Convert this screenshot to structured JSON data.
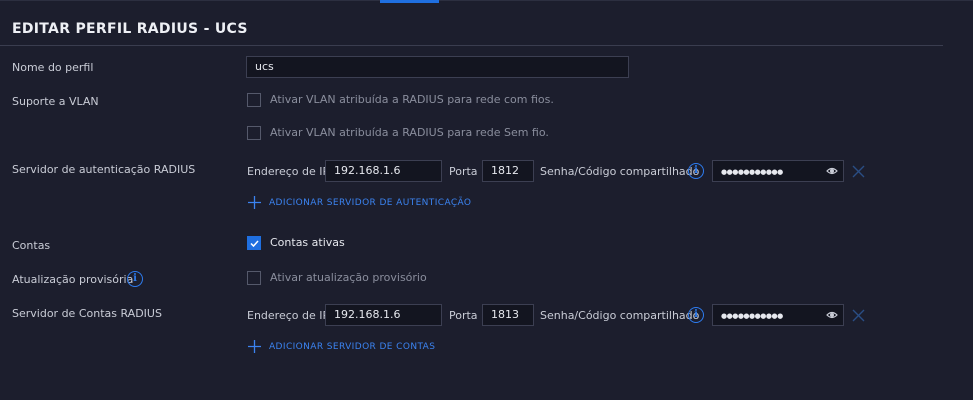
{
  "header": {
    "title": "EDITAR PERFIL RADIUS - UCS"
  },
  "profile": {
    "label": "Nome do perfil",
    "value": "ucs"
  },
  "vlan": {
    "label": "Suporte a VLAN",
    "wired_label": "Ativar VLAN atribuída a RADIUS para rede com fios.",
    "wireless_label": "Ativar VLAN atribuída a RADIUS para rede Sem fio."
  },
  "auth_server": {
    "label": "Servidor de autenticação RADIUS",
    "ip_label": "Endereço de IP",
    "ip_value": "192.168.1.6",
    "port_label": "Porta",
    "port_value": "1812",
    "secret_label": "Senha/Código compartilhado",
    "secret_value": "●●●●●●●●●●●",
    "add_label": "ADICIONAR SERVIDOR DE AUTENTICAÇÃO"
  },
  "accounting": {
    "label": "Contas",
    "enabled_label": "Contas ativas",
    "enabled": true
  },
  "interim": {
    "label": "Atualização provisória",
    "checkbox_label": "Ativar atualização provisório"
  },
  "acct_server": {
    "label": "Servidor de Contas RADIUS",
    "ip_label": "Endereço de IP",
    "ip_value": "192.168.1.6",
    "port_label": "Porta",
    "port_value": "1813",
    "secret_label": "Senha/Código compartilhado",
    "secret_value": "●●●●●●●●●●●",
    "add_label": "ADICIONAR SERVIDOR DE CONTAS"
  },
  "colors": {
    "accent": "#1f6fe0",
    "background": "#1c1e2d"
  }
}
